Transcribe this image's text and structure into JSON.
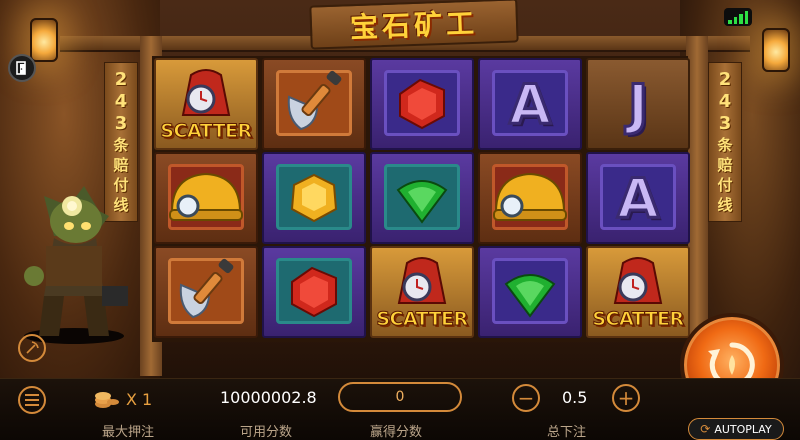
{
  "header": {
    "title": "宝石矿工",
    "signal_icon": "signal-bars-icon",
    "exit_icon": "exit-door-icon"
  },
  "banners": {
    "left": [
      "2",
      "4",
      "3",
      "条",
      "赔",
      "付",
      "线"
    ],
    "right": [
      "2",
      "4",
      "3",
      "条",
      "赔",
      "付",
      "线"
    ]
  },
  "reels": [
    [
      {
        "symbol": "scatter",
        "label": "SCATTER",
        "icon": "scatter-bag-icon"
      },
      {
        "symbol": "helmet",
        "icon": "miner-helmet-icon"
      },
      {
        "symbol": "shovel",
        "icon": "shovel-icon"
      }
    ],
    [
      {
        "symbol": "shovel",
        "icon": "shovel-icon"
      },
      {
        "symbol": "yellow-gem",
        "icon": "yellow-gem-icon"
      },
      {
        "symbol": "red-gem",
        "icon": "red-gem-icon"
      }
    ],
    [
      {
        "symbol": "red-gem",
        "icon": "red-gem-icon"
      },
      {
        "symbol": "green-gem",
        "icon": "green-gem-icon"
      },
      {
        "symbol": "scatter",
        "label": "SCATTER",
        "icon": "scatter-bag-icon"
      }
    ],
    [
      {
        "symbol": "A",
        "label": "A"
      },
      {
        "symbol": "helmet",
        "icon": "miner-helmet-icon"
      },
      {
        "symbol": "green-gem",
        "icon": "green-gem-icon"
      }
    ],
    [
      {
        "symbol": "J",
        "label": "J"
      },
      {
        "symbol": "A",
        "label": "A"
      },
      {
        "symbol": "scatter",
        "label": "SCATTER",
        "icon": "scatter-bag-icon"
      }
    ]
  ],
  "controls": {
    "max_bet_multiplier": "X 1",
    "max_bet_label": "最大押注",
    "balance": "10000002.8",
    "balance_label": "可用分数",
    "win": "0",
    "win_label": "赢得分数",
    "bet": "0.5",
    "bet_label": "总下注",
    "minus": "−",
    "plus": "+",
    "autoplay_label": "AUTOPLAY",
    "menu_icon": "menu-icon",
    "spin_icon": "spin-icon"
  },
  "colors": {
    "accent": "#d48a3a",
    "title": "#ffd23a",
    "spin": "#f06a14",
    "signal": "#2ee045"
  }
}
